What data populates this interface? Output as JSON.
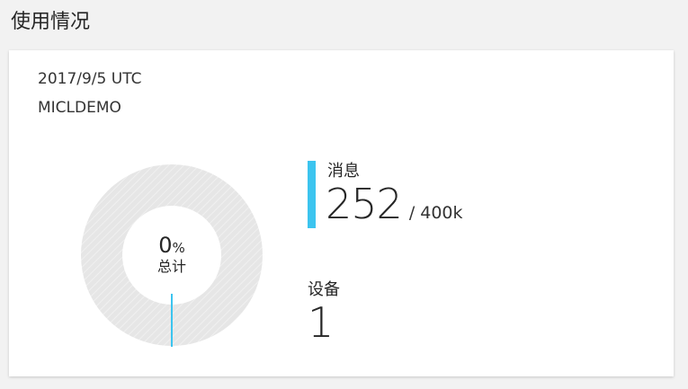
{
  "section": {
    "title": "使用情况"
  },
  "card": {
    "date": "2017/9/5 UTC",
    "hub_name": "MICLDEMO"
  },
  "donut": {
    "percent": "0",
    "percent_sign": "%",
    "label": "总计",
    "fraction_used": 0.0
  },
  "messages": {
    "label": "消息",
    "value": "252",
    "limit": "/ 400k"
  },
  "devices": {
    "label": "设备",
    "value": "1"
  },
  "colors": {
    "accent": "#3cc4ef",
    "ring_track": "#e5e5e5",
    "ring_hatch": "#efefef",
    "card_bg": "#ffffff",
    "page_bg": "#f2f2f2"
  }
}
